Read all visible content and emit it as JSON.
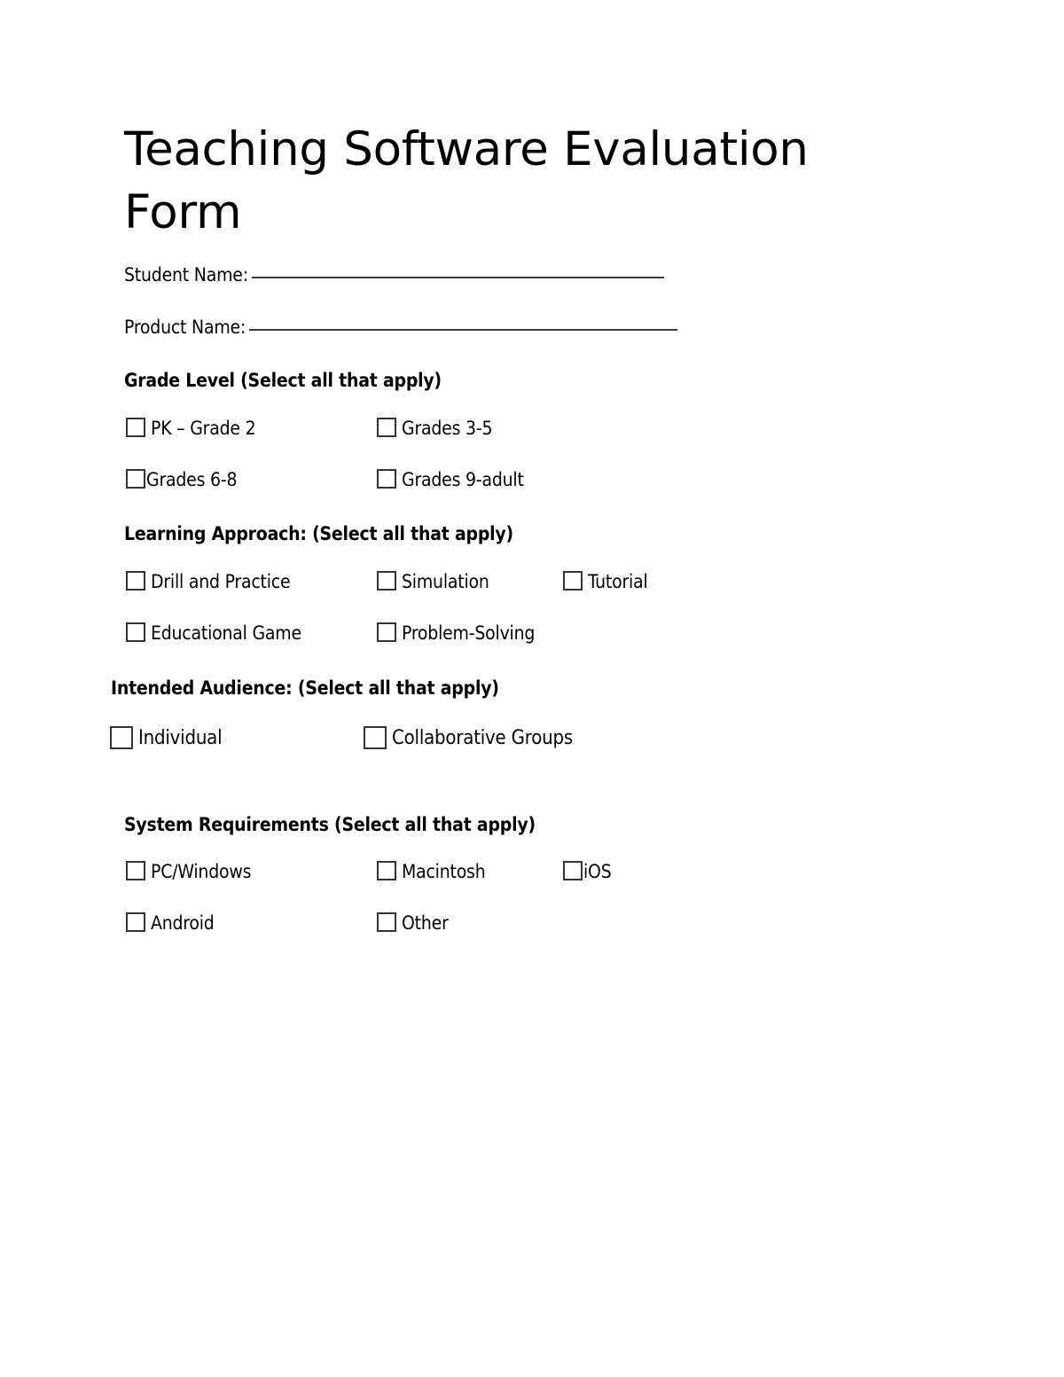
{
  "document": {
    "title": "Teaching Software Evaluation Form",
    "title_line1": "Teaching Software Evaluation",
    "title_line2": "Form"
  },
  "fields": [
    {
      "label": "Student Name:",
      "value": "",
      "rule_width": 465
    },
    {
      "label": "Product Name:",
      "value": "",
      "rule_width": 483
    }
  ],
  "sections": [
    {
      "heading": "Grade Level (Select all that apply)",
      "options": [
        {
          "label": "PK – Grade 2",
          "checked": false
        },
        {
          "label": "Grades 3-5",
          "checked": false
        },
        {
          "label": "Grades 6-8",
          "checked": false
        },
        {
          "label": "Grades 9-adult",
          "checked": false
        }
      ]
    },
    {
      "heading": "Learning Approach: (Select all that apply)",
      "options": [
        {
          "label": "Drill and Practice",
          "checked": false
        },
        {
          "label": "Simulation",
          "checked": false
        },
        {
          "label": "Tutorial",
          "checked": false
        },
        {
          "label": "Educational Game",
          "checked": false
        },
        {
          "label": "Problem-Solving",
          "checked": false
        }
      ]
    },
    {
      "heading": "Intended Audience: (Select all that apply)",
      "options": [
        {
          "label": "Individual",
          "checked": false
        },
        {
          "label": "Collaborative Groups",
          "checked": false
        }
      ]
    },
    {
      "heading": "System Requirements (Select all that apply)",
      "options": [
        {
          "label": "PC/Windows",
          "checked": false
        },
        {
          "label": "Macintosh",
          "checked": false
        },
        {
          "label": "iOS",
          "checked": false
        },
        {
          "label": "Android",
          "checked": false
        },
        {
          "label": "Other",
          "checked": false
        }
      ]
    }
  ],
  "colors": {
    "page_background": "#ffffff",
    "text": "#000000",
    "rule": "#3a3a3a",
    "checkbox_border": "#333333"
  }
}
